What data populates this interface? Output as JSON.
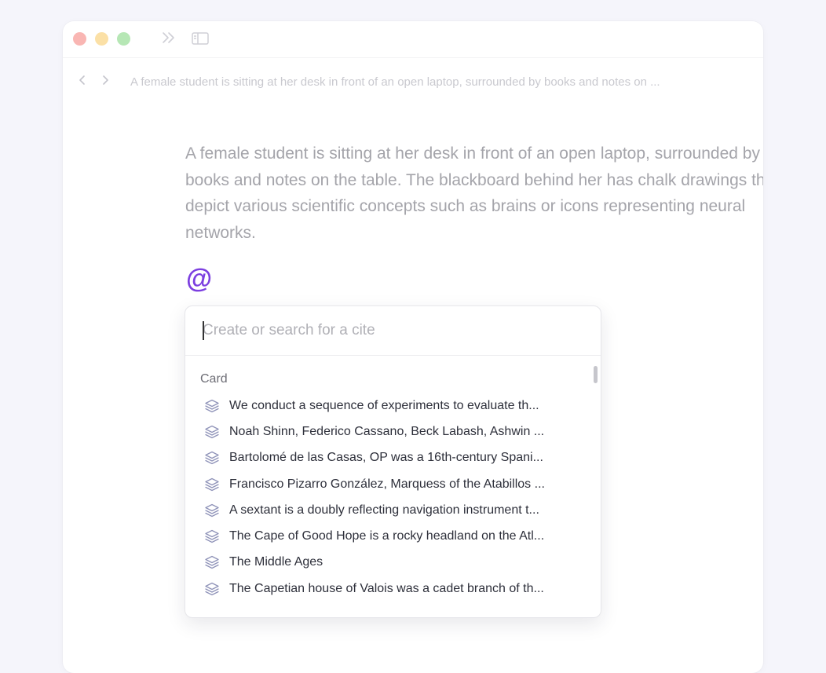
{
  "window": {
    "traffic_lights": [
      "close",
      "minimize",
      "zoom"
    ],
    "toolbar_icons": [
      "expand-icon",
      "sidebar-icon"
    ]
  },
  "nav": {
    "back_icon": "chevron-left-icon",
    "forward_icon": "chevron-right-icon",
    "breadcrumb": "A female student is sitting at her desk in front of an open laptop, surrounded by books and notes on ..."
  },
  "document": {
    "paragraph": "A female student is sitting at her desk in front of an open laptop, surrounded by books and notes on the table. The blackboard behind her has chalk drawings that depict various scientific concepts such as brains or icons representing neural networks.",
    "trigger": "@"
  },
  "cite_popup": {
    "search": {
      "placeholder": "Create or search for a cite",
      "value": ""
    },
    "section_label": "Card",
    "item_icon": "stack-layers-icon",
    "items": [
      {
        "label": "We conduct a sequence of experiments to evaluate th..."
      },
      {
        "label": "Noah Shinn, Federico Cassano, Beck Labash, Ashwin ..."
      },
      {
        "label": "Bartolomé de las Casas, OP was a 16th-century Spani..."
      },
      {
        "label": "Francisco Pizarro González, Marquess of the Atabillos ..."
      },
      {
        "label": "A sextant is a doubly reflecting navigation instrument t..."
      },
      {
        "label": "The Cape of Good Hope is a rocky headland on the Atl..."
      },
      {
        "label": "The Middle Ages"
      },
      {
        "label": "The Capetian house of Valois was a cadet branch of th..."
      }
    ]
  },
  "colors": {
    "accent": "#7c3fe0",
    "close": "#f9b6b3",
    "minimize": "#fbe0a6",
    "zoom": "#b6e7b5"
  }
}
